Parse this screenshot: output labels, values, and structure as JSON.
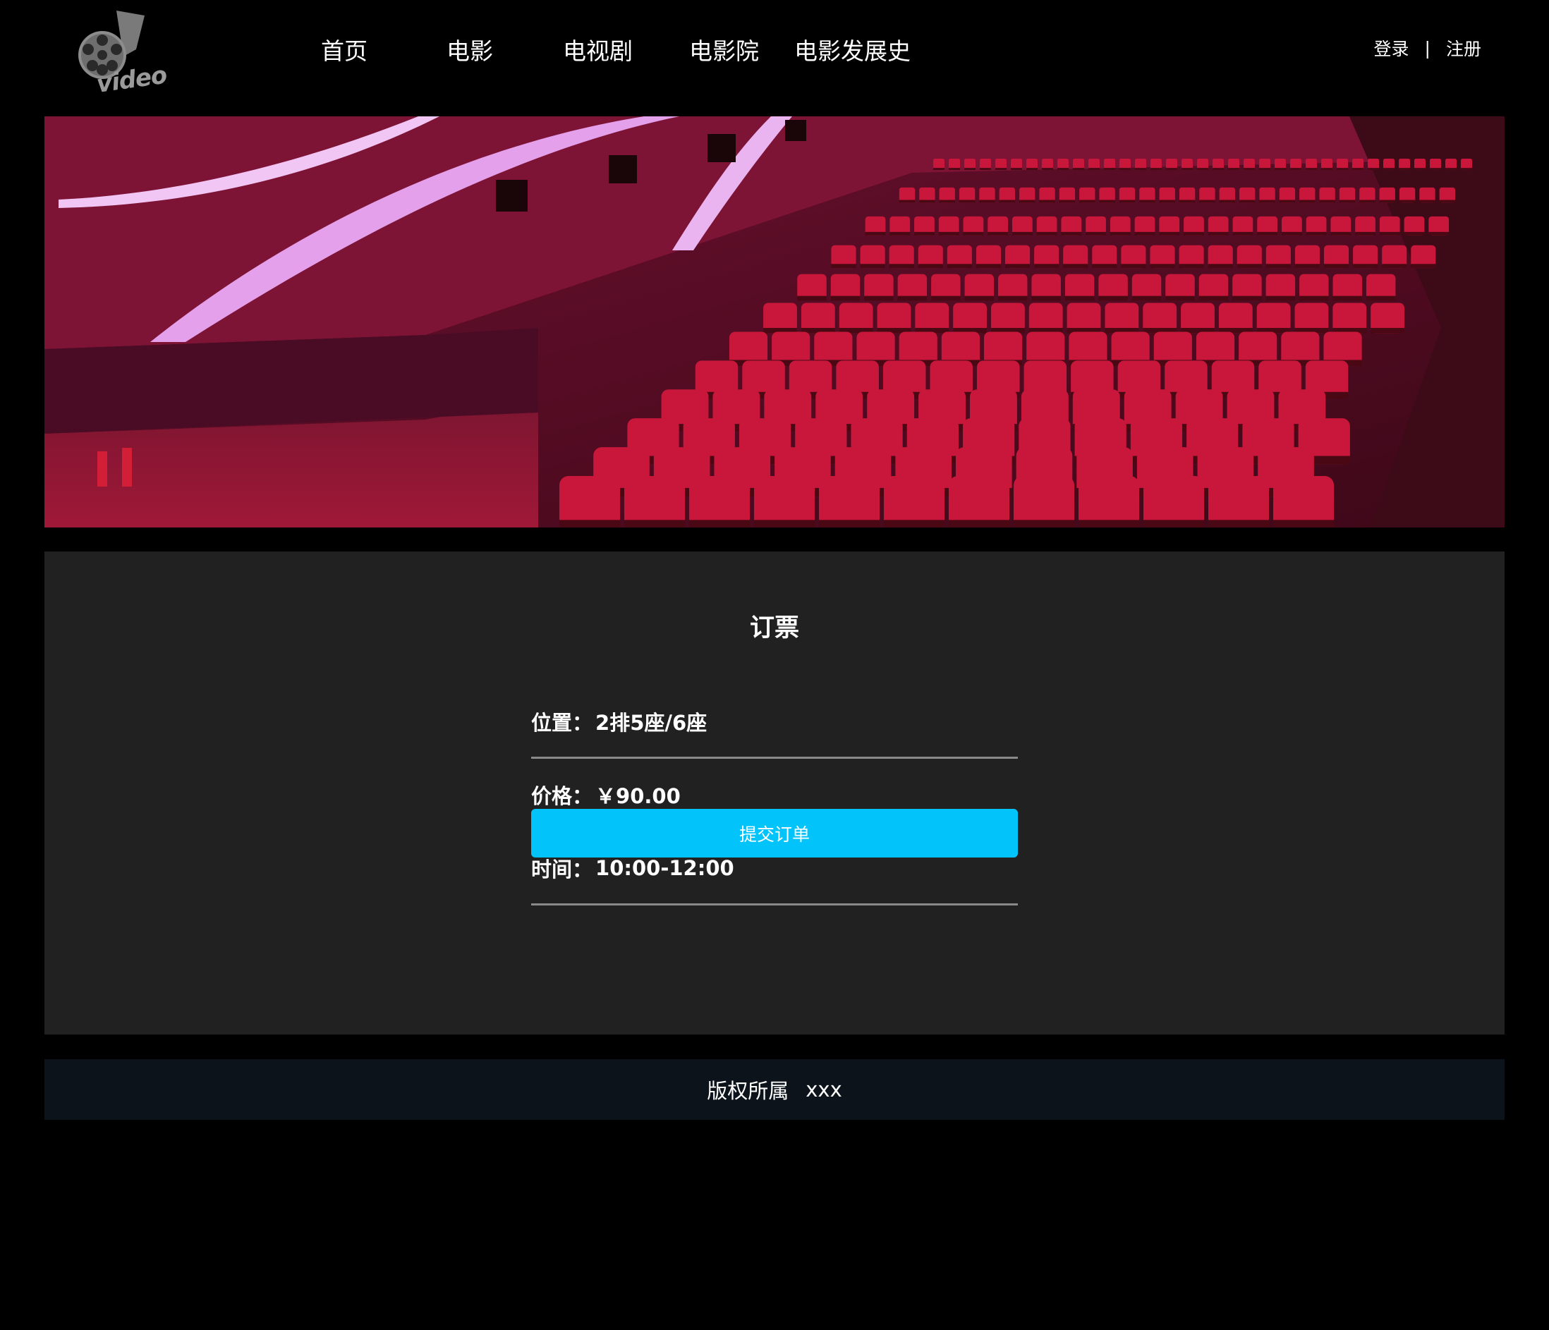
{
  "header": {
    "logo_text": "video",
    "nav": [
      {
        "label": "首页"
      },
      {
        "label": "电影"
      },
      {
        "label": "电视剧"
      },
      {
        "label": "电影院"
      },
      {
        "label": "电影发展史"
      }
    ],
    "login_label": "登录",
    "separator": "|",
    "register_label": "注册"
  },
  "banner": {
    "icon": "cinema-hall-image"
  },
  "booking": {
    "title": "订票",
    "rows": [
      {
        "label": "位置：",
        "value": "2排5座/6座"
      },
      {
        "label": "价格：",
        "value": "￥90.00"
      },
      {
        "label": "时间：",
        "value": "10:00-12:00"
      }
    ],
    "submit_label": "提交订单"
  },
  "footer": {
    "copyright": "版权所属",
    "owner": "xxx"
  },
  "colors": {
    "background": "#000000",
    "panel": "#212121",
    "footer": "#0c131b",
    "accent": "#03c3fb",
    "seat": "#c8173a"
  }
}
